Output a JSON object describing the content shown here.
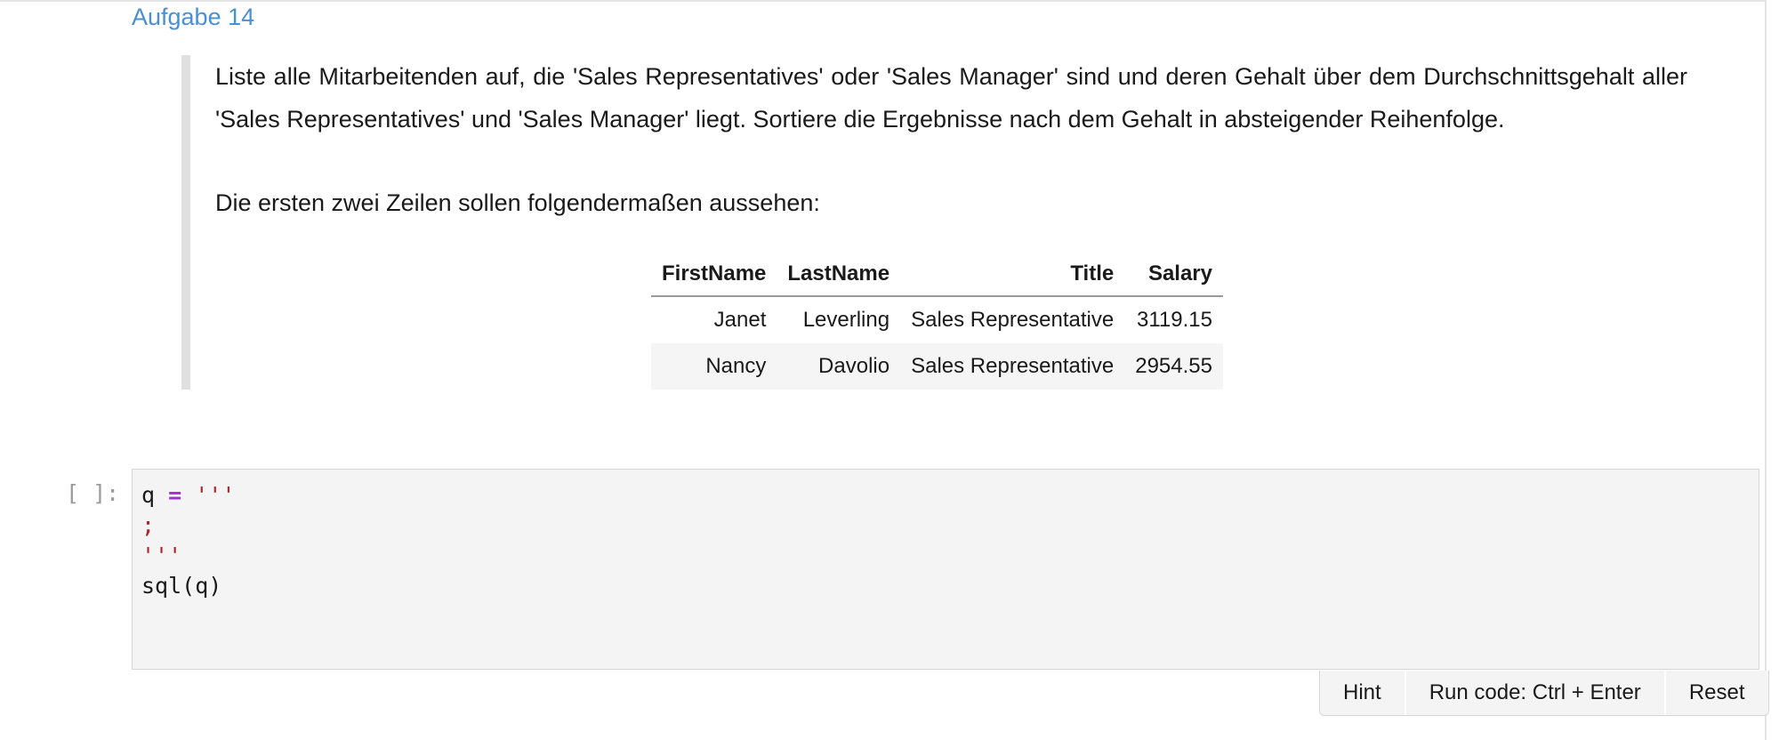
{
  "heading": "Aufgabe 14",
  "instructions": {
    "paragraph1": "Liste alle Mitarbeitenden auf, die 'Sales Representatives' oder 'Sales Manager' sind und deren Gehalt über dem Durchschnittsgehalt aller 'Sales Representatives' und 'Sales Manager' liegt. Sortiere die Ergebnisse nach dem Gehalt in absteigender Reihenfolge.",
    "paragraph2": "Die ersten zwei Zeilen sollen folgendermaßen aussehen:"
  },
  "example_table": {
    "columns": [
      "FirstName",
      "LastName",
      "Title",
      "Salary"
    ],
    "rows": [
      [
        "Janet",
        "Leverling",
        "Sales Representative",
        "3119.15"
      ],
      [
        "Nancy",
        "Davolio",
        "Sales Representative",
        "2954.55"
      ]
    ]
  },
  "cell": {
    "prompt": "[ ]:",
    "code": {
      "line1_var": "q",
      "line1_op": "=",
      "line1_str": "'''",
      "line2": ";",
      "line3": "'''",
      "line4": "sql(q)"
    }
  },
  "buttons": {
    "hint": "Hint",
    "run": "Run code: Ctrl + Enter",
    "reset": "Reset"
  }
}
